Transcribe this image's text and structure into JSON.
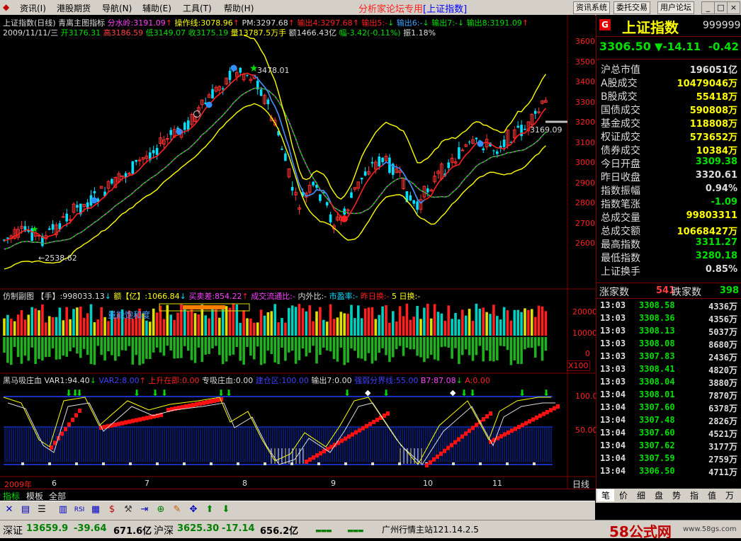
{
  "menu": {
    "items": [
      "资讯(I)",
      "港股期货",
      "导航(N)",
      "辅助(E)",
      "工具(T)",
      "帮助(H)"
    ],
    "title_main": "分析家论坛专用",
    "title_sub": "[上证指数]",
    "right_buttons": [
      "资讯系统",
      "委托交易",
      "用户论坛"
    ],
    "window_buttons": [
      "_",
      "□",
      "×"
    ]
  },
  "main_chart": {
    "title": "上证指数(日线)",
    "indicator_name": "青离主图指标",
    "fen_shui_ling": "分水岭:3191.09",
    "cao_zuo_xian": "操作线:3078.96",
    "pm": "PM:3297.68",
    "out4": "输出4:3297.68",
    "out5": "输出5:-",
    "out6": "输出6:-",
    "out7": "输出7:-",
    "out8": "输出8:3191.09",
    "date": "2009/11/11/三",
    "open": "开3176.31",
    "high": "高3186.59",
    "low": "低3149.07",
    "close": "收3175.19",
    "volume": "量13787.5万手",
    "amount": "额1466.43亿",
    "change": "幅-3.42(-0.11%)",
    "amplitude": "振1.18%",
    "high_mark": "3478.01",
    "low_mark": "←2538.62",
    "last_mark": "3169.09",
    "y_ticks": [
      "3600",
      "3500",
      "3400",
      "3300",
      "3200",
      "3100",
      "3000",
      "2900",
      "2800",
      "2700",
      "2600"
    ]
  },
  "vol_chart": {
    "name": "仿制副图",
    "shou": "【手】:998033.13",
    "e": "额【亿】:1066.84",
    "mai_mai_cha": "买卖差:854.22",
    "liu_tong_bi": "成交流通比:-",
    "nei_wai_bi": "内外比:-",
    "shi_ying_lv": "市盈率:-",
    "zuo_ri_huan": "昨日换:-",
    "wu_ri_huan": "5 日换:-",
    "annotation": "量能饱和度",
    "y_ticks": [
      "20000",
      "10000",
      "0"
    ],
    "unit": "X100"
  },
  "osc_chart": {
    "name": "黑马吸庄血",
    "var1": "VAR1:94.40",
    "var2": "VAR2:8.00",
    "shang_sheng": "上升在即:0.00",
    "zhuan_xi": "专吸庄血:0.00",
    "jian_cang": "建仓区:100.00",
    "out7": "输出7:0.00",
    "qiang_ruo": "强弱分界线:55.00",
    "b7": "B7:87.08",
    "a": "A:0.00",
    "y_ticks": [
      "100.0",
      "50.00"
    ]
  },
  "x_axis": {
    "labels": [
      "2009年",
      "6",
      "7",
      "8",
      "9",
      "10",
      "11"
    ],
    "period": "日线"
  },
  "bottom_tabs": [
    "指标",
    "模板",
    "全部"
  ],
  "quote": {
    "badge": "G",
    "name": "上证指数",
    "code": "999999",
    "price": "3306.50",
    "change": "▼-14.11",
    "pct": "-0.42",
    "rows": [
      {
        "k": "沪总市值",
        "v": "196051亿",
        "c": "#dddddd"
      },
      {
        "k": "A股成交",
        "v": "10479046万",
        "c": "#ffff00"
      },
      {
        "k": "B股成交",
        "v": "55418万",
        "c": "#ffff00"
      },
      {
        "k": "国债成交",
        "v": "590808万",
        "c": "#ffff00"
      },
      {
        "k": "基金成交",
        "v": "118808万",
        "c": "#ffff00"
      },
      {
        "k": "权证成交",
        "v": "573652万",
        "c": "#ffff00"
      },
      {
        "k": "债券成交",
        "v": "10384万",
        "c": "#ffff00"
      },
      {
        "k": "今日开盘",
        "v": "3309.38",
        "c": "#00e000"
      },
      {
        "k": "昨日收盘",
        "v": "3320.61",
        "c": "#dddddd"
      },
      {
        "k": "指数振幅",
        "v": "0.94%",
        "c": "#dddddd"
      },
      {
        "k": "指数笔涨",
        "v": "-1.09",
        "c": "#00e000"
      },
      {
        "k": "总成交量",
        "v": "99803311",
        "c": "#ffff00"
      },
      {
        "k": "总成交额",
        "v": "10668427万",
        "c": "#ffff00"
      },
      {
        "k": "最高指数",
        "v": "3311.27",
        "c": "#00e000"
      },
      {
        "k": "最低指数",
        "v": "3280.18",
        "c": "#00e000"
      },
      {
        "k": "上证换手",
        "v": "0.85%",
        "c": "#dddddd"
      }
    ],
    "up_label": "涨家数",
    "up_count": "541",
    "down_label": "跌家数",
    "down_count": "398"
  },
  "trades": [
    {
      "t": "13:03",
      "p": "3308.58",
      "q": "4336万"
    },
    {
      "t": "13:03",
      "p": "3308.36",
      "q": "4356万"
    },
    {
      "t": "13:03",
      "p": "3308.13",
      "q": "5037万"
    },
    {
      "t": "13:03",
      "p": "3308.08",
      "q": "8680万"
    },
    {
      "t": "13:03",
      "p": "3307.83",
      "q": "2436万"
    },
    {
      "t": "13:03",
      "p": "3308.41",
      "q": "4820万"
    },
    {
      "t": "13:03",
      "p": "3308.04",
      "q": "3880万"
    },
    {
      "t": "13:04",
      "p": "3308.01",
      "q": "7870万"
    },
    {
      "t": "13:04",
      "p": "3307.60",
      "q": "6378万"
    },
    {
      "t": "13:04",
      "p": "3307.48",
      "q": "2826万"
    },
    {
      "t": "13:04",
      "p": "3307.60",
      "q": "4521万"
    },
    {
      "t": "13:04",
      "p": "3307.62",
      "q": "3177万"
    },
    {
      "t": "13:04",
      "p": "3307.59",
      "q": "2759万"
    },
    {
      "t": "13:04",
      "p": "3306.50",
      "q": "4711万"
    }
  ],
  "right_tabs": [
    "笔",
    "价",
    "细",
    "盘",
    "势",
    "指",
    "值",
    "万"
  ],
  "toolbar_icons": [
    "x-icon",
    "chart-icon",
    "list-icon",
    "bar-chart-icon",
    "rsi-icon",
    "chart-up-icon",
    "dollar-icon",
    "wrench-icon",
    "export-icon",
    "zoom-icon",
    "pencil-icon",
    "move-icon",
    "up-arrow-icon",
    "down-arrow-icon"
  ],
  "status": {
    "sz_name": "深证",
    "sz_val": "13659.9",
    "sz_chg": "-39.64",
    "sz_amt": "671.6亿",
    "hs_name": "沪深",
    "hs_val": "3625.30",
    "hs_chg": "-17.14",
    "hs_amt": "656.2亿",
    "server": "广州行情主站121.14.2.5",
    "watermark": "58公式网",
    "watermark_url": "www.58gs.com"
  }
}
